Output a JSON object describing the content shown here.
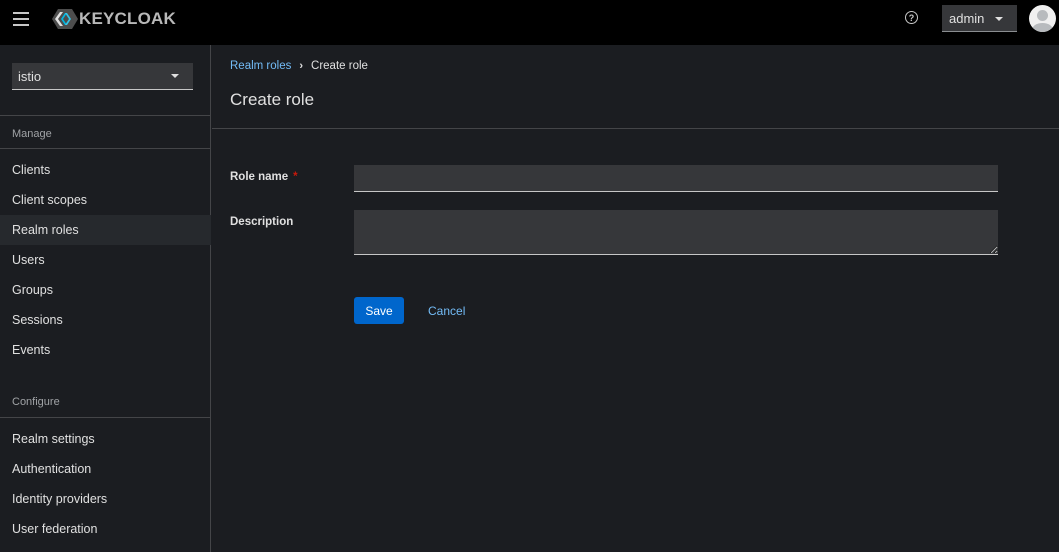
{
  "masthead": {
    "brand": "KEYCLOAK",
    "icons": {
      "menu": "hamburger-icon",
      "help": "help-circle-icon",
      "avatar": "user-avatar-icon"
    },
    "help_glyph": "?",
    "user_menu_label": "admin"
  },
  "sidebar": {
    "realm": "istio",
    "sections": [
      {
        "title": "Manage",
        "items": [
          {
            "label": "Clients",
            "active": false
          },
          {
            "label": "Client scopes",
            "active": false
          },
          {
            "label": "Realm roles",
            "active": true
          },
          {
            "label": "Users",
            "active": false
          },
          {
            "label": "Groups",
            "active": false
          },
          {
            "label": "Sessions",
            "active": false
          },
          {
            "label": "Events",
            "active": false
          }
        ]
      },
      {
        "title": "Configure",
        "items": [
          {
            "label": "Realm settings",
            "active": false
          },
          {
            "label": "Authentication",
            "active": false
          },
          {
            "label": "Identity providers",
            "active": false
          },
          {
            "label": "User federation",
            "active": false
          }
        ]
      }
    ]
  },
  "main": {
    "breadcrumb": [
      {
        "label": "Realm roles",
        "link": true
      },
      {
        "label": "Create role",
        "link": false
      }
    ],
    "breadcrumb_separator": "›",
    "title": "Create role",
    "form": {
      "role_name": {
        "label": "Role name",
        "required_marker": "*",
        "value": "",
        "placeholder": ""
      },
      "description": {
        "label": "Description",
        "value": "",
        "placeholder": ""
      }
    },
    "actions": {
      "save": "Save",
      "cancel": "Cancel"
    }
  },
  "colors": {
    "accent": "#0066cc",
    "link": "#73bcf7",
    "required": "#c9190b",
    "background": "#1b1d21",
    "masthead": "#000000"
  }
}
